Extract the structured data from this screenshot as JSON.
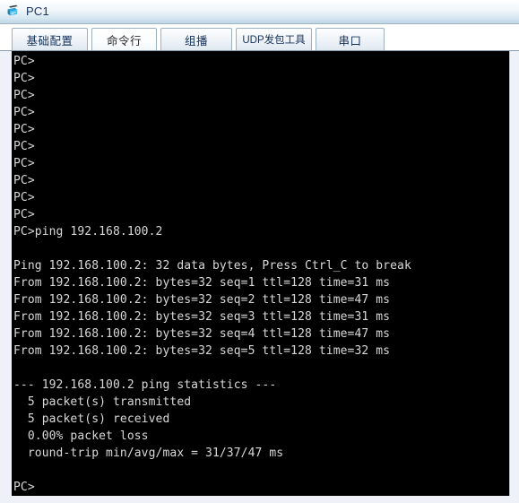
{
  "window": {
    "title": "PC1",
    "icon": "pc-host-icon"
  },
  "tabs": [
    {
      "label": "基础配置",
      "selected": false
    },
    {
      "label": "命令行",
      "selected": true
    },
    {
      "label": "组播",
      "selected": false
    },
    {
      "label": "UDP发包工具",
      "selected": false
    },
    {
      "label": "串口",
      "selected": false
    }
  ],
  "terminal": {
    "prompt": "PC>",
    "command": "ping 192.168.100.2",
    "target_ip": "192.168.100.2",
    "lines": [
      "PC>",
      "PC>",
      "PC>",
      "PC>",
      "PC>",
      "PC>",
      "PC>",
      "PC>",
      "PC>",
      "PC>",
      "PC>ping 192.168.100.2",
      "",
      "Ping 192.168.100.2: 32 data bytes, Press Ctrl_C to break",
      "From 192.168.100.2: bytes=32 seq=1 ttl=128 time=31 ms",
      "From 192.168.100.2: bytes=32 seq=2 ttl=128 time=47 ms",
      "From 192.168.100.2: bytes=32 seq=3 ttl=128 time=31 ms",
      "From 192.168.100.2: bytes=32 seq=4 ttl=128 time=47 ms",
      "From 192.168.100.2: bytes=32 seq=5 ttl=128 time=32 ms",
      "",
      "--- 192.168.100.2 ping statistics ---",
      "  5 packet(s) transmitted",
      "  5 packet(s) received",
      "  0.00% packet loss",
      "  round-trip min/avg/max = 31/37/47 ms",
      "",
      "PC>"
    ],
    "statistics": {
      "header": "--- 192.168.100.2 ping statistics ---",
      "transmitted": "5 packet(s) transmitted",
      "received": "5 packet(s) received",
      "loss": "0.00% packet loss",
      "round_trip": "round-trip min/avg/max = 31/37/47 ms",
      "packets_transmitted": 5,
      "packets_received": 5,
      "packet_loss_percent": "0.00%",
      "rtt_min_ms": 31,
      "rtt_avg_ms": 37,
      "rtt_max_ms": 47
    },
    "replies": [
      {
        "seq": 1,
        "bytes": 32,
        "ttl": 128,
        "time_ms": 31
      },
      {
        "seq": 2,
        "bytes": 32,
        "ttl": 128,
        "time_ms": 47
      },
      {
        "seq": 3,
        "bytes": 32,
        "ttl": 128,
        "time_ms": 31
      },
      {
        "seq": 4,
        "bytes": 32,
        "ttl": 128,
        "time_ms": 47
      },
      {
        "seq": 5,
        "bytes": 32,
        "ttl": 128,
        "time_ms": 32
      }
    ]
  },
  "colors": {
    "terminal_bg": "#000000",
    "terminal_fg": "#d8d8d8",
    "titlebar_accent": "#bfd7e6",
    "title_color": "#16325c",
    "icon_color": "#1f8dc4"
  }
}
